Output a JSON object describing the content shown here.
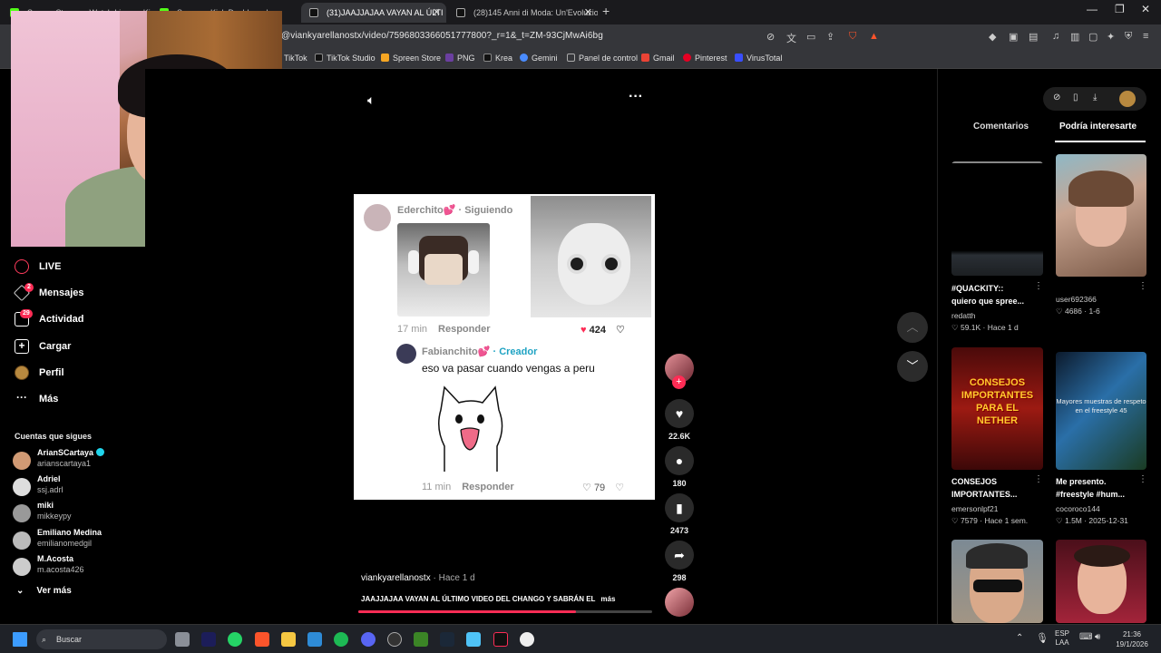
{
  "browser": {
    "tabs": [
      {
        "label": "Spreen Stream - Watch Live on Ki",
        "active": false
      },
      {
        "label": "Spreen - Kick Dashboard",
        "active": false
      },
      {
        "label": "(31)JAAJJAJAA VAYAN AL ÚLTI",
        "active": true
      },
      {
        "label": "(28)145 Anni di Moda: Un'Evoluzione",
        "active": false
      }
    ],
    "url": "@viankyarellanostx/video/7596803366051777800?_r=1&_t=ZM-93CjMwAi6bg",
    "bookmarks": [
      "TikTok",
      "TikTok Studio",
      "Spreen Store",
      "PNG",
      "Krea",
      "Gemini",
      "Panel de control",
      "Gmail",
      "Pinterest",
      "VirusTotal"
    ]
  },
  "sidebar": {
    "nav": [
      {
        "label": "LIVE",
        "icon": "live-icon"
      },
      {
        "label": "Mensajes",
        "icon": "messages-icon",
        "badge": "2"
      },
      {
        "label": "Actividad",
        "icon": "activity-icon",
        "badge": "29"
      },
      {
        "label": "Cargar",
        "icon": "upload-icon"
      },
      {
        "label": "Perfil",
        "icon": "profile-icon"
      },
      {
        "label": "Más",
        "icon": "more-icon"
      }
    ],
    "following_title": "Cuentas que sigues",
    "accounts": [
      {
        "name": "ArianSCartaya",
        "user": "arianscartaya1",
        "verified": true
      },
      {
        "name": "Adriel",
        "user": "ssj.adrl",
        "verified": false
      },
      {
        "name": "miki",
        "user": "mikkeypy",
        "verified": false
      },
      {
        "name": "Emiliano Medina",
        "user": "emilianomedgil",
        "verified": false
      },
      {
        "name": "M.Acosta",
        "user": "m.acosta426",
        "verified": false
      }
    ],
    "see_more": "Ver más"
  },
  "video": {
    "comment1": {
      "user": "Ederchito💕 · Siguiendo",
      "time": "17 min",
      "reply": "Responder",
      "likes": "424"
    },
    "comment2": {
      "user": "Fabianchito💕",
      "creator": "· Creador",
      "text": "eso va pasar cuando vengas a peru",
      "time": "11 min",
      "reply": "Responder",
      "likes": "79"
    },
    "author": "viankyarellanostx",
    "posted": "· Hace 1 d",
    "caption": "JAAJJAJAA VAYAN AL ÚLTIMO VIDEO DEL CHANGO Y SABRÁN EL",
    "caption_more": "más",
    "progress": 0.74
  },
  "actions": {
    "likes": "22.6K",
    "comments": "180",
    "saves": "2473",
    "shares": "298"
  },
  "right_panel": {
    "tabs": [
      "Comentarios",
      "Podría interesarte"
    ],
    "videos": [
      {
        "title": "#QUACKITY::\nquiero que spree...",
        "user": "redatth",
        "stats": "♡ 59.1K · Hace 1 d"
      },
      {
        "title": "",
        "user": "user692366",
        "stats": "♡ 4686 · 1-6"
      },
      {
        "title": "CONSEJOS\nIMPORTANTES...",
        "user": "emersonlpf21",
        "stats": "♡ 7579 · Hace 1 sem.",
        "overlay": "CONSEJOS IMPORTANTES PARA EL NETHER"
      },
      {
        "title": "Me presento.\n#freestyle #hum...",
        "user": "cocoroco144",
        "stats": "♡ 1.5M · 2025-12-31",
        "overlay": "Mayores muestras de respeto en el freestyle 45"
      }
    ]
  },
  "taskbar": {
    "search_placeholder": "Buscar",
    "lang": "ESP\nLAA",
    "time": "21:36",
    "date": "19/1/2026"
  }
}
